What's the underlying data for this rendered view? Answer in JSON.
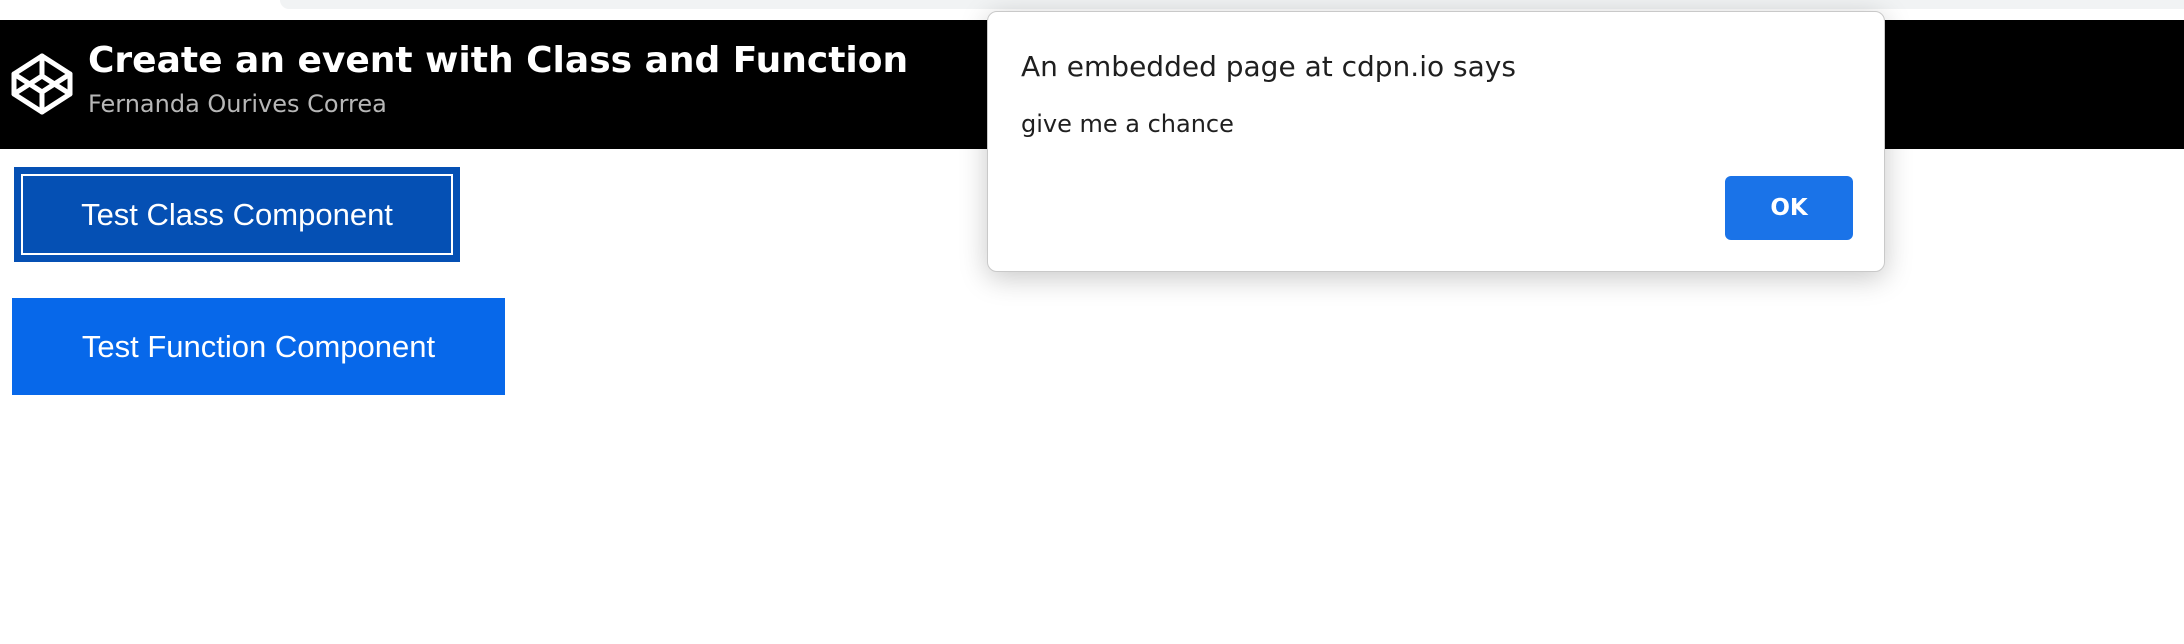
{
  "header": {
    "title": "Create an event with Class and Function",
    "author": "Fernanda Ourives Correa",
    "logo_icon": "codepen-logo-icon"
  },
  "main": {
    "class_button_label": "Test Class Component",
    "function_button_label": "Test Function Component"
  },
  "dialog": {
    "title": "An embedded page at cdpn.io says",
    "message": "give me a chance",
    "ok_label": "OK"
  },
  "colors": {
    "header_bg": "#000000",
    "class_button_bg": "#0550b4",
    "function_button_bg": "#0768ea",
    "dialog_button_bg": "#1a73e8"
  }
}
